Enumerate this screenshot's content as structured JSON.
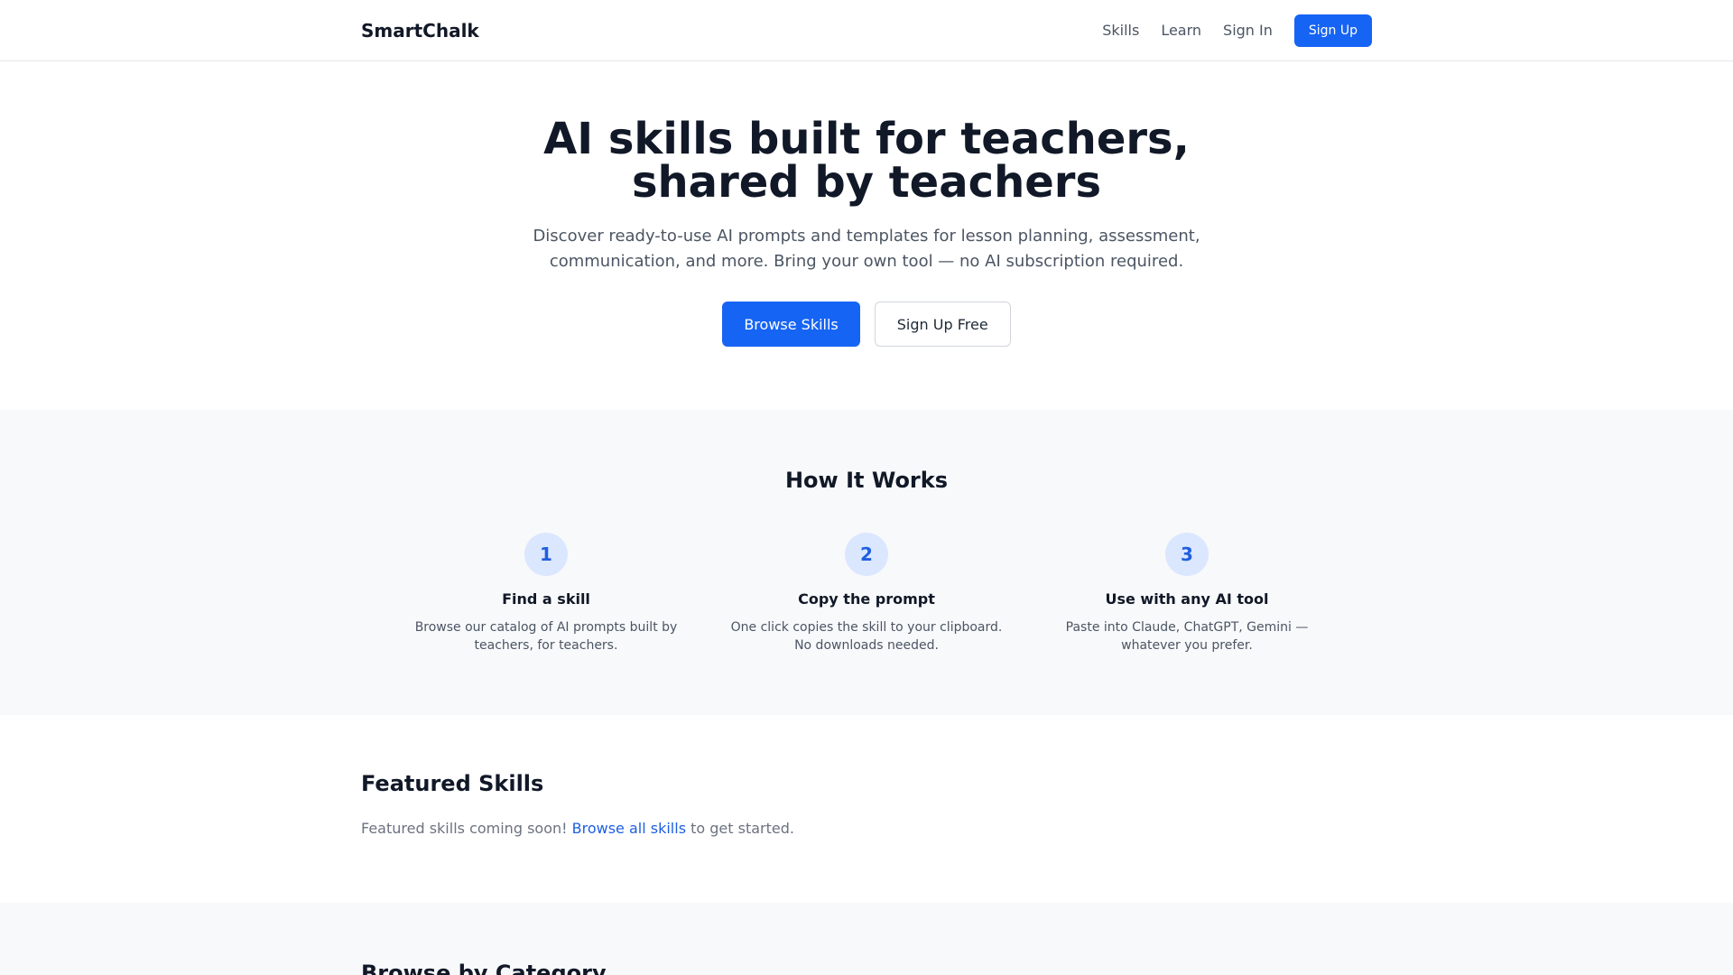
{
  "header": {
    "brand": "SmartChalk",
    "nav": {
      "skills": "Skills",
      "learn": "Learn",
      "sign_in": "Sign In",
      "sign_up": "Sign Up"
    }
  },
  "hero": {
    "title": "AI skills built for teachers, shared by teachers",
    "subtitle": "Discover ready-to-use AI prompts and templates for lesson planning, assessment, communication, and more. Bring your own tool — no AI subscription required.",
    "primary_cta": "Browse Skills",
    "secondary_cta": "Sign Up Free"
  },
  "how_it_works": {
    "title": "How It Works",
    "steps": [
      {
        "number": "1",
        "title": "Find a skill",
        "description": "Browse our catalog of AI prompts built by teachers, for teachers."
      },
      {
        "number": "2",
        "title": "Copy the prompt",
        "description": "One click copies the skill to your clipboard. No downloads needed."
      },
      {
        "number": "3",
        "title": "Use with any AI tool",
        "description": "Paste into Claude, ChatGPT, Gemini — whatever you prefer."
      }
    ]
  },
  "featured": {
    "title": "Featured Skills",
    "note_before": "Featured skills coming soon! ",
    "note_link": "Browse all skills",
    "note_after": " to get started."
  },
  "browse": {
    "title": "Browse by Category"
  },
  "colors": {
    "accent": "#1664f4",
    "step_circle_bg": "#dbe7fe",
    "section_bg": "#f8f9fb"
  }
}
